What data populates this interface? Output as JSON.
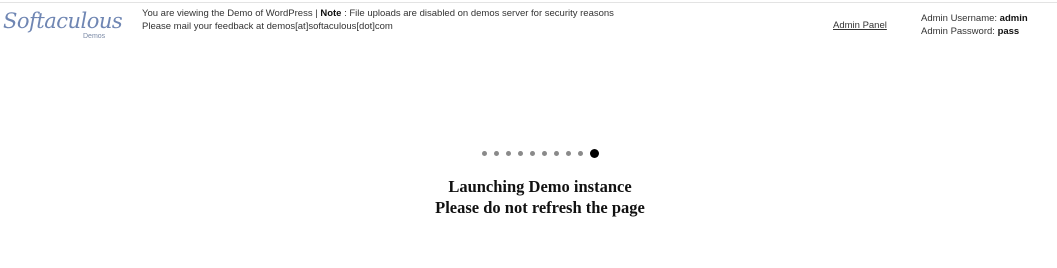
{
  "logo": {
    "wordmark": "Softaculous",
    "sub": "Demos"
  },
  "notice": {
    "line1_prefix": "You are viewing the Demo of ",
    "app_name": "WordPress",
    "separator": " | ",
    "note_label": "Note",
    "note_text": " : File uploads are disabled on demos server for security reasons",
    "line2": "Please mail your feedback at demos[at]softaculous[dot]com"
  },
  "admin_panel_link": "Admin Panel",
  "credentials": {
    "username_label": "Admin Username: ",
    "username": "admin",
    "password_label": "Admin Password: ",
    "password": "pass"
  },
  "loader": {
    "dot_count": 10,
    "active_index": 9
  },
  "status": {
    "line1": "Launching Demo instance",
    "line2": "Please do not refresh the page"
  }
}
